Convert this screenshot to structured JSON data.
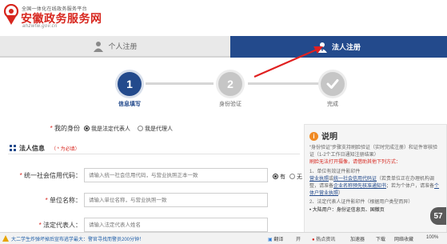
{
  "header": {
    "slogan": "全国一体化在线政务服务平台",
    "site_name": "安徽政务服务网",
    "url": "ahzwfw.gov.cn"
  },
  "tabs": [
    {
      "label": "个人注册",
      "active": false,
      "icon": "person-icon"
    },
    {
      "label": "法人注册",
      "active": true,
      "icon": "person-icon"
    }
  ],
  "steps": [
    {
      "number": "1",
      "label": "信息填写",
      "state": "active"
    },
    {
      "number": "2",
      "label": "身份验证",
      "state": "todo"
    },
    {
      "number": "",
      "label": "完成",
      "state": "todo",
      "icon": "check-icon"
    }
  ],
  "form": {
    "identity_label": "我的身份",
    "identity_options": [
      "我是法定代表人",
      "我是代理人"
    ],
    "identity_selected": "我是法定代表人",
    "section_title": "法人信息",
    "section_note": "（ * 为必填）",
    "fields": [
      {
        "label": "统一社会信用代码：",
        "placeholder": "请输入统一社会信用代码，与营业执照正本一致",
        "required": true
      },
      {
        "label": "单位名称：",
        "placeholder": "请输入单位名称，与营业执照一致",
        "required": true
      },
      {
        "label": "法定代表人：",
        "placeholder": "请输入法定代表人姓名",
        "required": true
      }
    ],
    "code_options": [
      "有",
      "无"
    ],
    "code_selected": "有"
  },
  "info": {
    "title": "说明",
    "paragraph1": "“身份验证”步骤支持刷脸验证（实时完成注册）和证件审核验证（1-2个工作日通知注册结果）",
    "paragraph1_red": "刷脸无法打开摄像，请借助其他下列方式：",
    "item1": "1、单位有效证件影印件",
    "item1_detail_a": "营业执照",
    "item1_detail_b": "或",
    "item1_detail_c": "统一社会信用代码证",
    "item1_detail_d": "（若贵单位正在办理机构调整，请准备",
    "item1_detail_e": "企业名称预先核准通知书",
    "item1_detail_f": "；若为个体户，请准备",
    "item1_detail_g": "个体户营业执照",
    "item1_detail_h": "）",
    "item2": "2、法定代表人证件影印件（根据用户类型而异）",
    "item2_detail": "• 大陆用户：身份证信息页、国徽页"
  },
  "taskbar": {
    "news": "大二学生炸弹坏掉后宣布逃学最大：警官寻找而警员200分钟！",
    "translate": "翻译",
    "open": "开",
    "items": [
      "加速器",
      "下载",
      "网络收藏"
    ],
    "zoom": "100%",
    "hotspot": "热点资讯"
  },
  "badge": "57",
  "colors": {
    "brand_red": "#d7261e",
    "brand_blue": "#234a8c"
  }
}
